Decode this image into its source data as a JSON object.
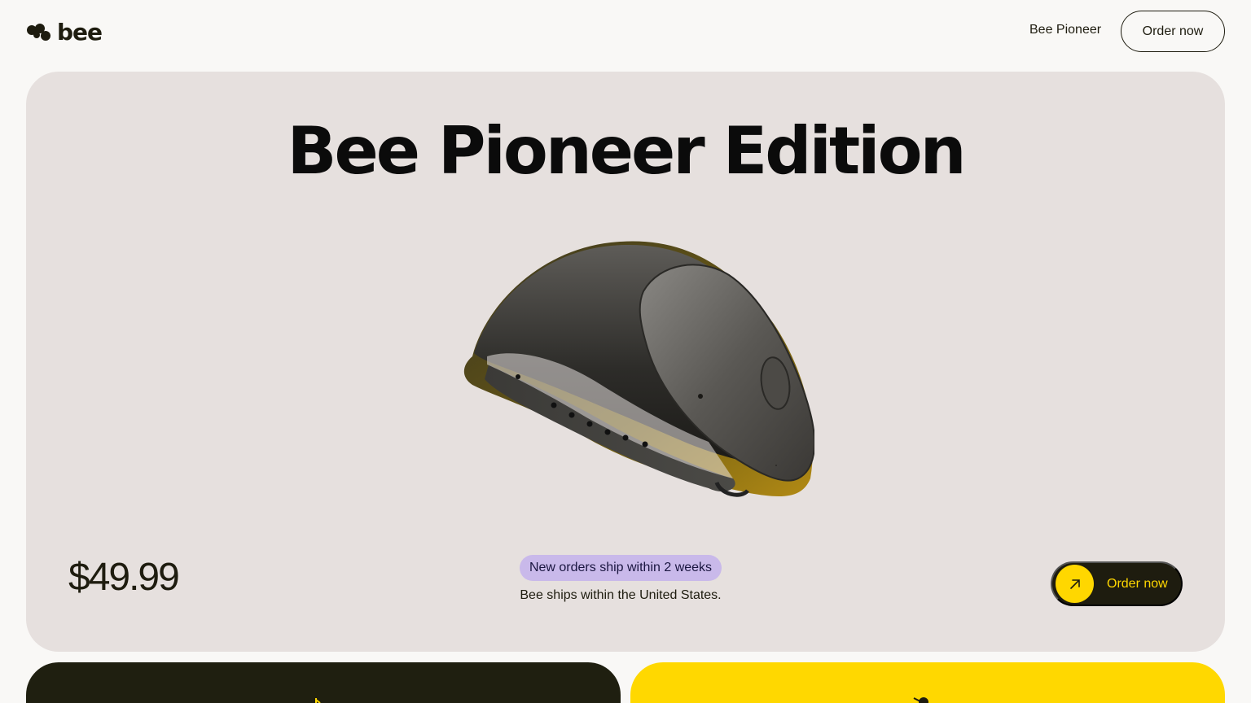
{
  "header": {
    "logo_text": "bee",
    "nav_link": "Bee Pioneer",
    "order_label": "Order now"
  },
  "hero": {
    "title": "Bee Pioneer Edition",
    "price": "$49.99",
    "ship_badge": "New orders ship within 2 weeks",
    "ship_note": "Bee ships within the United States.",
    "order_label": "Order now"
  },
  "colors": {
    "background": "#f9f8f6",
    "hero_card": "#e6e0de",
    "accent_yellow": "#ffd700",
    "dark": "#1e1c0f",
    "badge_purple": "#c9b9ea"
  },
  "icons": {
    "logo": "bee-logo-icon",
    "order_arrow": "arrow-up-right-icon"
  }
}
